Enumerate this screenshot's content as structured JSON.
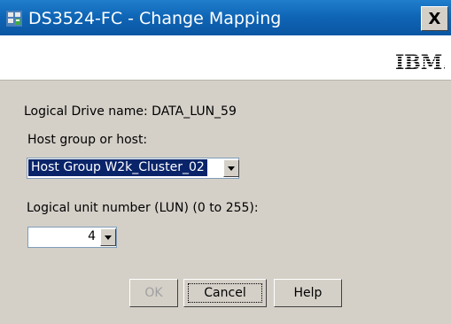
{
  "window": {
    "title": "DS3524-FC - Change Mapping",
    "close_glyph": "X",
    "icon": "storage-manager-icon"
  },
  "banner": {
    "logo_text": "IBM."
  },
  "form": {
    "logical_drive_label": "Logical Drive name: DATA_LUN_59",
    "host_label": "Host group or host:",
    "host_value": "Host Group W2k_Cluster_02",
    "lun_label": "Logical unit number (LUN) (0 to 255):",
    "lun_value": "4"
  },
  "buttons": {
    "ok": "OK",
    "cancel": "Cancel",
    "help": "Help"
  },
  "colors": {
    "titlebar": "#0f64b4",
    "dialog_background": "#d4d0c8",
    "selection": "#0a246a"
  }
}
